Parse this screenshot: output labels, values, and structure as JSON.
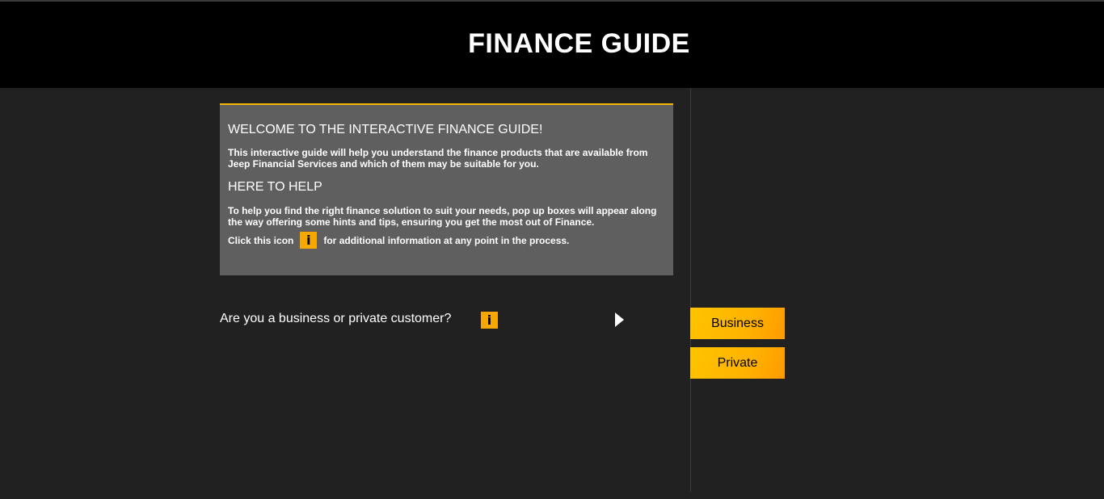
{
  "header": {
    "title": "FINANCE GUIDE"
  },
  "welcome": {
    "heading": "WELCOME TO THE INTERACTIVE FINANCE GUIDE!",
    "text": "This interactive guide will help you understand the finance products that are available from Jeep Financial Services and which of them may be suitable for you.",
    "help_heading": "HERE TO HELP",
    "help_text": "To help you find the right finance solution to suit your needs, pop up boxes will appear along the way offering some hints and tips, ensuring you get the most out of Finance.",
    "click_prefix": "Click this icon",
    "click_suffix": "for additional information at any point in the process.",
    "info_icon_glyph": "i"
  },
  "question": {
    "text": "Are you a business or private customer?",
    "info_icon_glyph": "i"
  },
  "choices": {
    "business_label": "Business",
    "private_label": "Private"
  },
  "icons": {
    "info": "info-icon",
    "arrow": "arrow-right-icon"
  },
  "colors": {
    "accent": "#f7a800",
    "header_bg": "#000000",
    "page_bg": "#212121",
    "box_bg": "#5f5f5f"
  }
}
